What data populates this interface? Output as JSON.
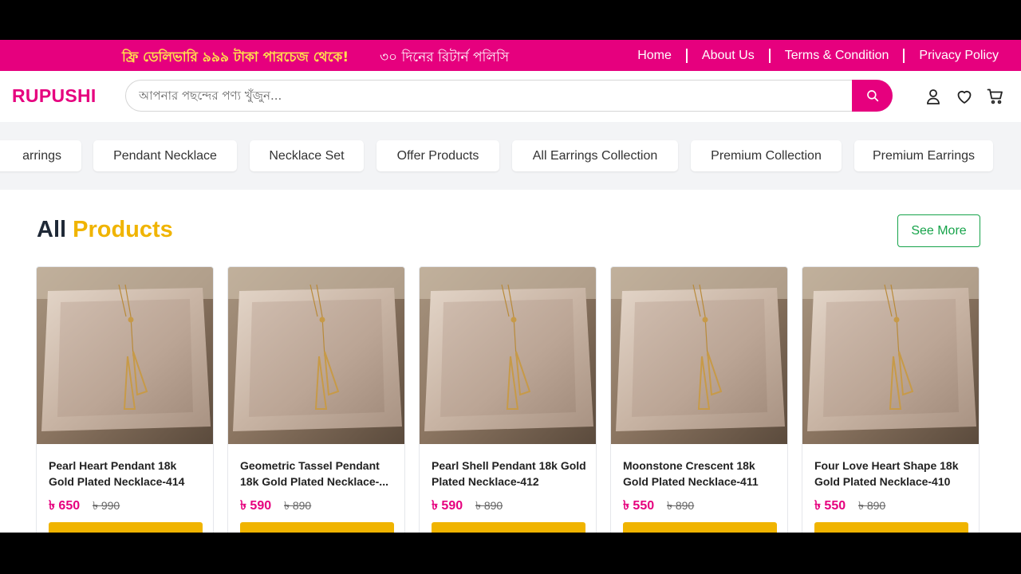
{
  "promo": {
    "free_delivery": "ফ্রি ডেলিভারি ৯৯৯ টাকা পারচেজ থেকে!",
    "return_policy": "৩০ দিনের রিটার্ন পলিসি"
  },
  "topnav": {
    "home": "Home",
    "about": "About Us",
    "terms": "Terms & Condition",
    "privacy": "Privacy Policy"
  },
  "header": {
    "logo": "RUPUSHI",
    "search_placeholder": "আপনার পছন্দের পণ্য খুঁজুন..."
  },
  "categories": [
    "arrings",
    "Pendant Necklace",
    "Necklace Set",
    "Offer Products",
    "All Earrings Collection",
    "Premium Collection",
    "Premium Earrings"
  ],
  "section": {
    "title_a": "All",
    "title_b": "Products",
    "see_more": "See More"
  },
  "products": [
    {
      "name": "Pearl Heart Pendant 18k Gold Plated Necklace-414",
      "price": "৳ 650",
      "old_price": "৳ 990"
    },
    {
      "name": "Geometric Tassel Pendant 18k Gold Plated Necklace-...",
      "price": "৳ 590",
      "old_price": "৳ 890"
    },
    {
      "name": "Pearl Shell Pendant 18k Gold Plated Necklace-412",
      "price": "৳ 590",
      "old_price": "৳ 890"
    },
    {
      "name": "Moonstone Crescent 18k Gold Plated Necklace-411",
      "price": "৳ 550",
      "old_price": "৳ 890"
    },
    {
      "name": "Four Love Heart Shape 18k Gold Plated Necklace-410",
      "price": "৳ 550",
      "old_price": "৳ 890"
    }
  ],
  "colors": {
    "brand_pink": "#e6007e",
    "accent_yellow": "#f0b400",
    "see_more_green": "#16a34a"
  }
}
